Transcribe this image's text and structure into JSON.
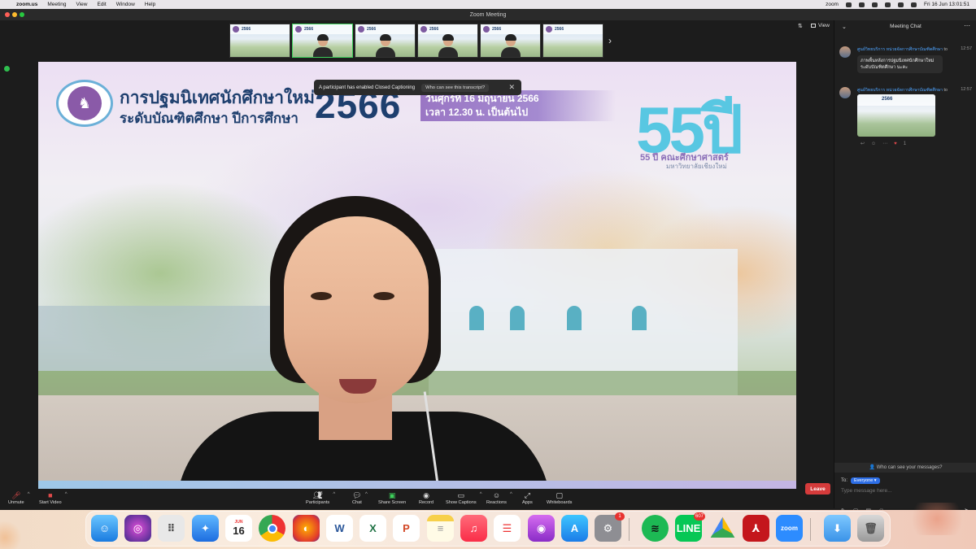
{
  "menubar": {
    "app": "zoom.us",
    "items": [
      "Meeting",
      "View",
      "Edit",
      "Window",
      "Help"
    ],
    "clock": "Fri 16 Jun  13:01:51",
    "zoom_status": "zoom"
  },
  "window": {
    "title": "Zoom Meeting",
    "view_label": "View"
  },
  "thumbnails": {
    "banner_year": "2566",
    "count": 6
  },
  "main_video": {
    "banner": {
      "title_line1": "การปฐมนิเทศนักศึกษาใหม่",
      "title_line2": "ระดับบัณฑิตศึกษา ปีการศึกษา",
      "year": "2566",
      "date_line1": "วันศุกร์ที่ 16 มิถุนายน 2566",
      "date_line2": "เวลา 12.30 น. เป็นต้นไป",
      "anniversary_number": "55ปี",
      "anniversary_caption": "55 ปี คณะศึกษาศาสตร์",
      "anniversary_sub": "มหาวิทยาลัยเชียงใหม่"
    },
    "toast": {
      "message": "A participant has enabled Closed Captioning",
      "link": "Who can see this transcript?",
      "close": "✕"
    }
  },
  "chat": {
    "title": "Meeting Chat",
    "messages": [
      {
        "sender": "ศูนย์วิทยบริการ หน่วยจัดการศึกษาบัณฑิตศึกษา",
        "to": "to",
        "time": "12:57",
        "text": "ภาพพื้นหลังการปฐมนิเทศนักศึกษาใหม่ ระดับบัณฑิตศึกษา นะคะ"
      },
      {
        "sender": "ศูนย์วิทยบริการ หน่วยจัดการศึกษาบัณฑิตศึกษา",
        "to": "to",
        "time": "12:57",
        "image_label": "2566",
        "reaction_count": "1"
      }
    ],
    "privacy_text": "Who can see your messages?",
    "to_label": "To:",
    "recipient": "Everyone",
    "input_placeholder": "Type message here..."
  },
  "toolbar": {
    "unmute": "Unmute",
    "start_video": "Start Video",
    "participants": "Participants",
    "participants_count": "68",
    "chat": "Chat",
    "share_screen": "Share Screen",
    "record": "Record",
    "show_captions": "Show Captions",
    "reactions": "Reactions",
    "apps": "Apps",
    "whiteboards": "Whiteboards",
    "leave": "Leave"
  },
  "dock": {
    "calendar_month": "JUN",
    "calendar_day": "16",
    "settings_badge": "1",
    "line_badge": "607",
    "word_letter": "W",
    "excel_letter": "X",
    "ppt_letter": "P",
    "zoom_label": "zoom"
  }
}
